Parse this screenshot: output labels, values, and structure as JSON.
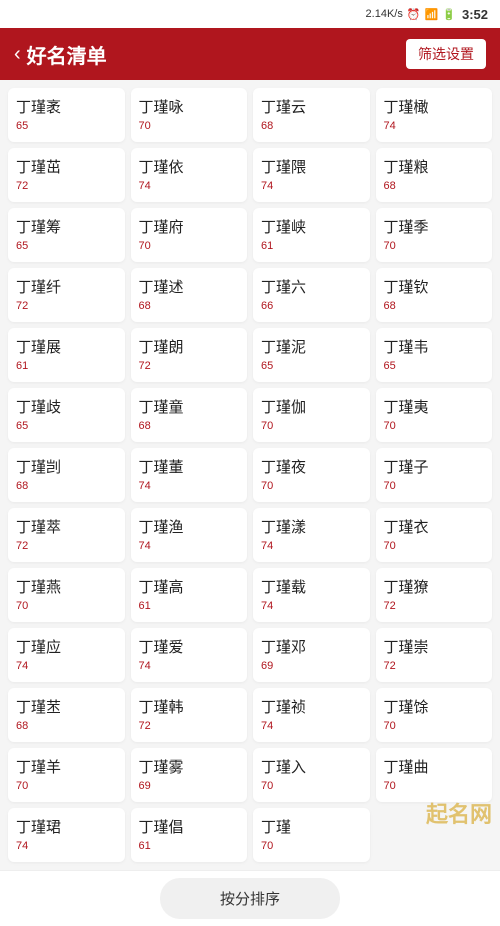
{
  "statusBar": {
    "speed": "2.14K/s",
    "time": "3:52"
  },
  "header": {
    "backLabel": "‹",
    "title": "好名清单",
    "filterLabel": "筛选设置"
  },
  "names": [
    {
      "name": "丁瑾袤",
      "score": 65
    },
    {
      "name": "丁瑾咏",
      "score": 70
    },
    {
      "name": "丁瑾云",
      "score": 68
    },
    {
      "name": "丁瑾橄",
      "score": 74
    },
    {
      "name": "丁瑾茁",
      "score": 72
    },
    {
      "name": "丁瑾依",
      "score": 74
    },
    {
      "name": "丁瑾隈",
      "score": 74
    },
    {
      "name": "丁瑾粮",
      "score": 68
    },
    {
      "name": "丁瑾筹",
      "score": 65
    },
    {
      "name": "丁瑾府",
      "score": 70
    },
    {
      "name": "丁瑾峡",
      "score": 61
    },
    {
      "name": "丁瑾季",
      "score": 70
    },
    {
      "name": "丁瑾纤",
      "score": 72
    },
    {
      "name": "丁瑾述",
      "score": 68
    },
    {
      "name": "丁瑾六",
      "score": 66
    },
    {
      "name": "丁瑾钦",
      "score": 68
    },
    {
      "name": "丁瑾展",
      "score": 61
    },
    {
      "name": "丁瑾朗",
      "score": 72
    },
    {
      "name": "丁瑾泥",
      "score": 65
    },
    {
      "name": "丁瑾韦",
      "score": 65
    },
    {
      "name": "丁瑾歧",
      "score": 65
    },
    {
      "name": "丁瑾童",
      "score": 68
    },
    {
      "name": "丁瑾伽",
      "score": 70
    },
    {
      "name": "丁瑾夷",
      "score": 70
    },
    {
      "name": "丁瑾剀",
      "score": 68
    },
    {
      "name": "丁瑾董",
      "score": 74
    },
    {
      "name": "丁瑾夜",
      "score": 70
    },
    {
      "name": "丁瑾子",
      "score": 70
    },
    {
      "name": "丁瑾萃",
      "score": 72
    },
    {
      "name": "丁瑾渔",
      "score": 74
    },
    {
      "name": "丁瑾漾",
      "score": 74
    },
    {
      "name": "丁瑾衣",
      "score": 70
    },
    {
      "name": "丁瑾燕",
      "score": 70
    },
    {
      "name": "丁瑾高",
      "score": 61
    },
    {
      "name": "丁瑾载",
      "score": 74
    },
    {
      "name": "丁瑾獠",
      "score": 72
    },
    {
      "name": "丁瑾应",
      "score": 74
    },
    {
      "name": "丁瑾爱",
      "score": 74
    },
    {
      "name": "丁瑾邓",
      "score": 69
    },
    {
      "name": "丁瑾崇",
      "score": 72
    },
    {
      "name": "丁瑾苤",
      "score": 68
    },
    {
      "name": "丁瑾韩",
      "score": 72
    },
    {
      "name": "丁瑾祯",
      "score": 74
    },
    {
      "name": "丁瑾馀",
      "score": 70
    },
    {
      "name": "丁瑾羊",
      "score": 70
    },
    {
      "name": "丁瑾雾",
      "score": 69
    },
    {
      "name": "丁瑾入",
      "score": 70
    },
    {
      "name": "丁瑾曲",
      "score": 70
    },
    {
      "name": "丁瑾珺",
      "score": 74
    },
    {
      "name": "丁瑾倡",
      "score": 61
    },
    {
      "name": "丁瑾",
      "score": 70
    },
    {
      "name": "",
      "score": null
    }
  ],
  "bottomBar": {
    "sortLabel": "按分排序"
  },
  "watermark": {
    "logo": "起名网"
  }
}
